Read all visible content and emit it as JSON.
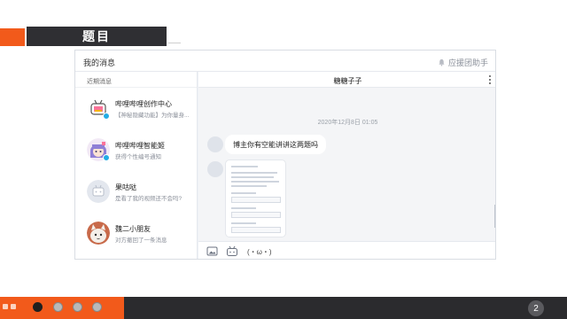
{
  "slide": {
    "title": "题目",
    "page_number": "2"
  },
  "app": {
    "window_title": "我的消息",
    "helper_label": "应援团助手",
    "sidebar_heading": "近期消息",
    "conversations": [
      {
        "name": "哔哩哔哩创作中心",
        "preview": "【神秘隐藏功能】为你量身..."
      },
      {
        "name": "哔哩哔哩智能姬",
        "preview": "获得个性编号通知"
      },
      {
        "name": "果咕哒",
        "preview": "是看了我的视频还不会吗?"
      },
      {
        "name": "魏二小朋友",
        "preview": "对方撤回了一条消息"
      }
    ],
    "chat": {
      "contact_name": "糖糖子子",
      "timestamp": "2020年12月8日 01:05",
      "message_text": "博主你有空能讲讲这两题吗",
      "emoticon": "(・ω・)"
    }
  },
  "colors": {
    "accent_orange": "#f25a1b",
    "title_bar": "#2f2f33",
    "badge_blue": "#23ade5"
  }
}
